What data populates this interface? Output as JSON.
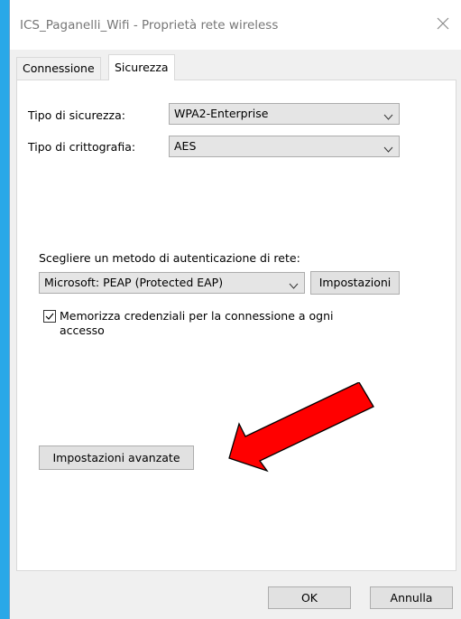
{
  "window": {
    "title": "ICS_Paganelli_Wifi - Proprietà rete wireless"
  },
  "tabs": [
    {
      "label": "Connessione",
      "active": false
    },
    {
      "label": "Sicurezza",
      "active": true
    }
  ],
  "security": {
    "type_label": "Tipo di sicurezza:",
    "type_value": "WPA2-Enterprise",
    "encryption_label": "Tipo di crittografia:",
    "encryption_value": "AES",
    "auth_method_label": "Scegliere un metodo di autenticazione di rete:",
    "auth_method_value": "Microsoft: PEAP (Protected EAP)",
    "settings_button": "Impostazioni",
    "remember_checkbox": {
      "line1": "Memorizza credenziali per la connessione a ogni",
      "line2": "accesso",
      "checked": true
    },
    "advanced_button": "Impostazioni avanzate"
  },
  "footer": {
    "ok_button": "OK",
    "cancel_button": "Annulla"
  },
  "colors": {
    "background": "#29a8e8",
    "dialog": "#f0f0f0",
    "annotation_arrow": "#ff0000"
  },
  "icons": {
    "close": "close-icon",
    "dropdown": "chevron-down-icon",
    "check": "check-icon",
    "annotation": "red-arrow-icon"
  }
}
